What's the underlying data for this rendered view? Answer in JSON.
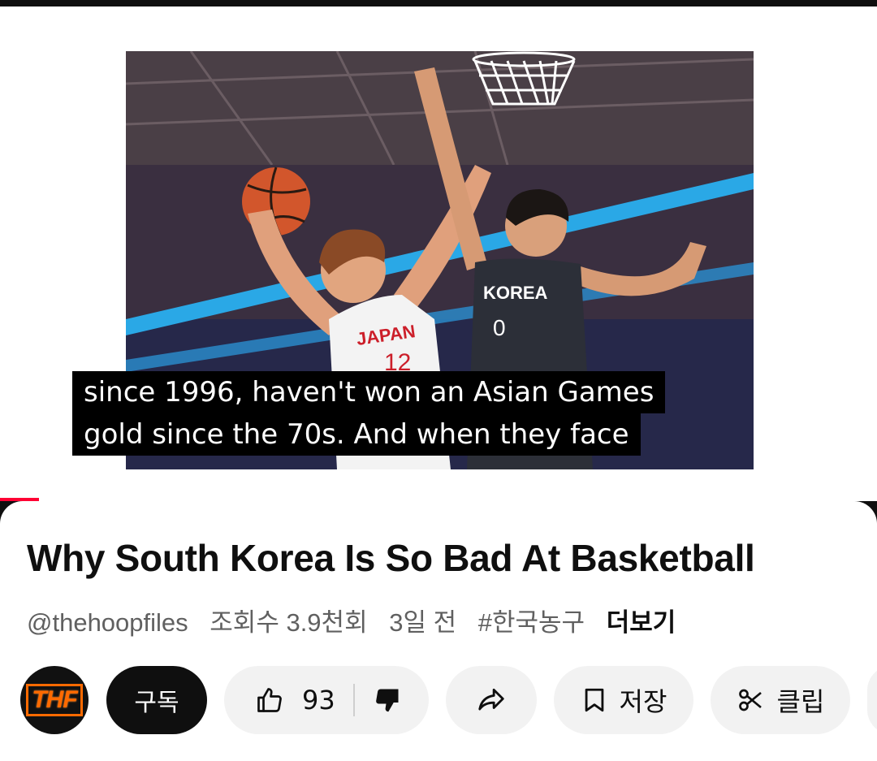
{
  "caption": {
    "line1": "since 1996, haven't won an Asian Games",
    "line2": "gold since the 70s. And when they face"
  },
  "thumbnail": {
    "left_jersey_text": "JAPAN",
    "left_jersey_number": "12",
    "right_jersey_text": "KOREA",
    "right_jersey_number": "0"
  },
  "video": {
    "title": "Why South Korea Is So Bad At Basketball",
    "channel_handle": "@thehoopfiles",
    "views": "조회수 3.9천회",
    "age": "3일 전",
    "hashtag": "#한국농구",
    "more_label": "더보기"
  },
  "actions": {
    "avatar_text": "THF",
    "subscribe_label": "구독",
    "like_count": "93",
    "save_label": "저장",
    "clip_label": "클립"
  },
  "colors": {
    "accent_red": "#ff0033",
    "pill_bg": "#f2f2f2",
    "text_primary": "#0f0f0f",
    "text_secondary": "#606060"
  },
  "icons": {
    "like": "thumbs-up-icon",
    "dislike": "thumbs-down-icon",
    "share": "share-arrow-icon",
    "save": "bookmark-icon",
    "clip": "scissors-icon"
  }
}
